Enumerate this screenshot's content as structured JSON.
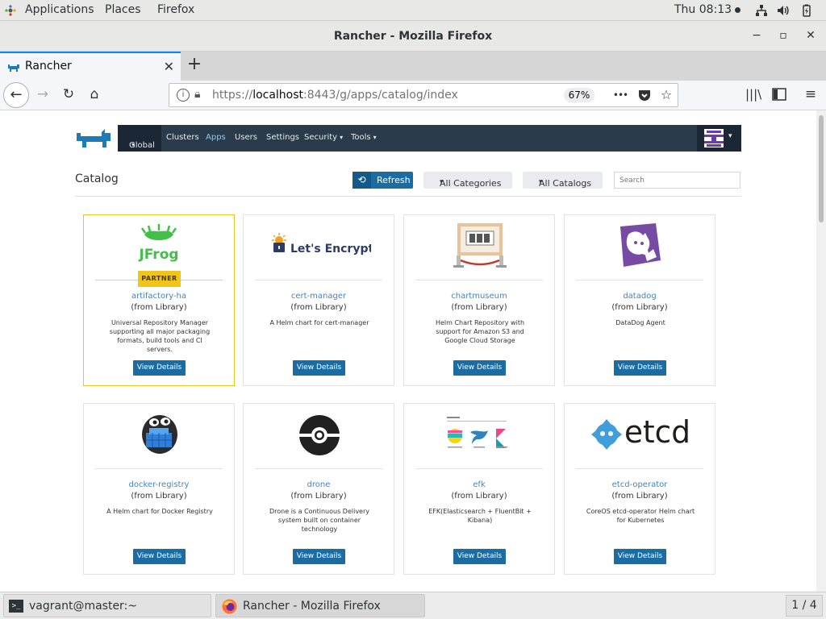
{
  "topbar": {
    "applications": "Applications",
    "places": "Places",
    "firefox": "Firefox",
    "clock": "Thu 08:13",
    "icons": [
      "network-icon",
      "volume-icon",
      "battery-icon"
    ]
  },
  "window": {
    "title": "Rancher - Mozilla Firefox",
    "minimize": "−",
    "maximize": "▫",
    "close": "✕"
  },
  "tabs": [
    {
      "title": "Rancher",
      "close": "✕",
      "active": true
    }
  ],
  "newtab_label": "+",
  "navbar": {
    "url_prefix": "https://",
    "url_host": "localhost",
    "url_rest": ":8443/g/apps/catalog/index",
    "zoom": "67%",
    "more": "•••"
  },
  "rancher": {
    "nav": {
      "global": "Global",
      "clusters": "Clusters",
      "apps": "Apps",
      "users": "Users",
      "settings": "Settings",
      "security": "Security",
      "tools": "Tools"
    },
    "page_title": "Catalog",
    "refresh": "Refresh",
    "categories": "All Categories",
    "catalogs": "All Catalogs",
    "search_placeholder": "Search",
    "colors": {
      "nav_bg": "#2a3b4c",
      "button": "#1a6ca3",
      "link": "#3d86c6",
      "partner": "#f0c419"
    }
  },
  "cards": [
    {
      "name": "artifactory-ha",
      "from": "(from Library)",
      "desc": "Universal Repository Manager supporting all major packaging formats, build tools and CI servers.",
      "button": "View Details",
      "badge": "PARTNER",
      "logo_text": "JFrog"
    },
    {
      "name": "cert-manager",
      "from": "(from Library)",
      "desc": "A Helm chart for cert-manager",
      "button": "View Details",
      "logo_text": "Let's Encrypt"
    },
    {
      "name": "chartmuseum",
      "from": "(from Library)",
      "desc": "Helm Chart Repository with support for Amazon S3 and Google Cloud Storage",
      "button": "View Details"
    },
    {
      "name": "datadog",
      "from": "(from Library)",
      "desc": "DataDog Agent",
      "button": "View Details"
    },
    {
      "name": "docker-registry",
      "from": "(from Library)",
      "desc": "A Helm chart for Docker Registry",
      "button": "View Details"
    },
    {
      "name": "drone",
      "from": "(from Library)",
      "desc": "Drone is a Continuous Delivery system built on container technology",
      "button": "View Details"
    },
    {
      "name": "efk",
      "from": "(from Library)",
      "desc": "EFK(Elasticsearch + FluentBit + Kibana)",
      "button": "View Details"
    },
    {
      "name": "etcd-operator",
      "from": "(from Library)",
      "desc": "CoreOS etcd-operator Helm chart for Kubernetes",
      "button": "View Details",
      "logo_text": "etcd"
    }
  ],
  "taskbar": {
    "terminal": "vagrant@master:~",
    "firefox": "Rancher - Mozilla Firefox",
    "workspace": "1 / 4"
  }
}
